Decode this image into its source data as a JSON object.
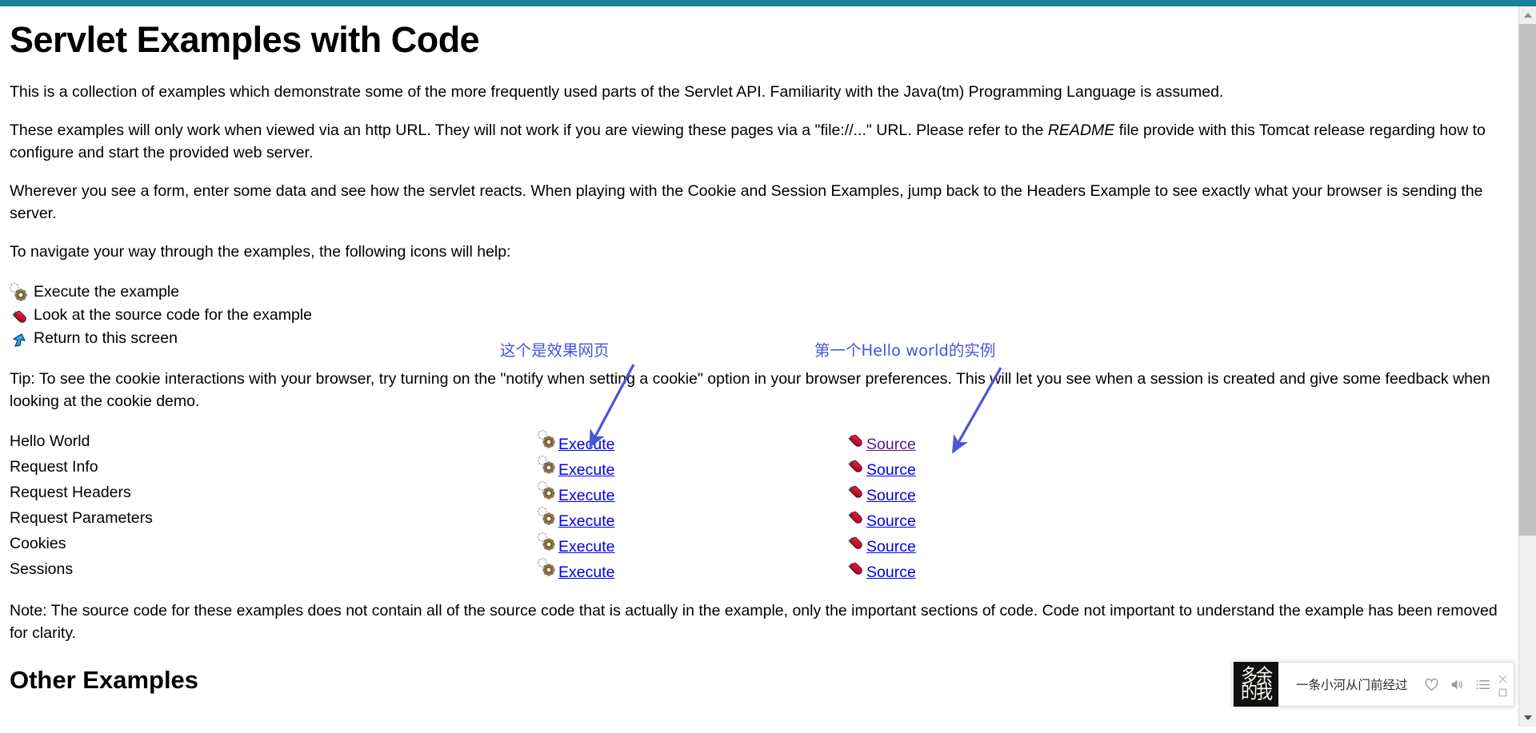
{
  "theme": {
    "topbar_color": "#17809a",
    "link_color": "#0000ee",
    "visited_link_color": "#551a8b",
    "annotation_color": "#4a55d8"
  },
  "page": {
    "title": "Servlet Examples with Code",
    "intro_paragraph": "This is a collection of examples which demonstrate some of the more frequently used parts of the Servlet API. Familiarity with the Java(tm) Programming Language is assumed.",
    "http_paragraph_1": "These examples will only work when viewed via an http URL. They will not work if you are viewing these pages via a \"file://...\" URL. Please refer to the ",
    "http_paragraph_readme": "README",
    "http_paragraph_2": " file provide with this Tomcat release regarding how to configure and start the provided web server.",
    "form_paragraph": "Wherever you see a form, enter some data and see how the servlet reacts. When playing with the Cookie and Session Examples, jump back to the Headers Example to see exactly what your browser is sending the server.",
    "navigate_paragraph": "To navigate your way through the examples, the following icons will help:",
    "tip_paragraph": "Tip: To see the cookie interactions with your browser, try turning on the \"notify when setting a cookie\" option in your browser preferences. This will let you see when a session is created and give some feedback when looking at the cookie demo.",
    "note_paragraph": "Note: The source code for these examples does not contain all of the source code that is actually in the example, only the important sections of code. Code not important to understand the example has been removed for clarity.",
    "other_examples_heading": "Other Examples"
  },
  "legend": [
    {
      "icon": "gears-icon",
      "label": "Execute the example"
    },
    {
      "icon": "screwdriver-icon",
      "label": "Look at the source code for the example"
    },
    {
      "icon": "return-arrow-icon",
      "label": "Return to this screen"
    }
  ],
  "examples_table": {
    "rows": [
      {
        "name": "Hello World",
        "execute_label": "Execute",
        "source_label": "Source",
        "source_visited": true
      },
      {
        "name": "Request Info",
        "execute_label": "Execute",
        "source_label": "Source",
        "source_visited": false
      },
      {
        "name": "Request Headers",
        "execute_label": "Execute",
        "source_label": "Source",
        "source_visited": false
      },
      {
        "name": "Request Parameters",
        "execute_label": "Execute",
        "source_label": "Source",
        "source_visited": false
      },
      {
        "name": "Cookies",
        "execute_label": "Execute",
        "source_label": "Source",
        "source_visited": false
      },
      {
        "name": "Sessions",
        "execute_label": "Execute",
        "source_label": "Source",
        "source_visited": false
      }
    ]
  },
  "annotations": [
    {
      "id": "annot-1",
      "text": "这个是效果网页"
    },
    {
      "id": "annot-2",
      "text": "第一个Hello world的实例"
    }
  ],
  "music_player": {
    "album_art_text": "多余的我",
    "song_title": "一条小河从门前经过",
    "icons": [
      "heart-icon",
      "speaker-icon",
      "playlist-icon"
    ],
    "window_buttons": [
      "close-icon",
      "minimize-icon"
    ]
  },
  "scrollbar": {
    "up_arrow": "scroll-up-icon",
    "down_arrow": "scroll-down-icon"
  }
}
